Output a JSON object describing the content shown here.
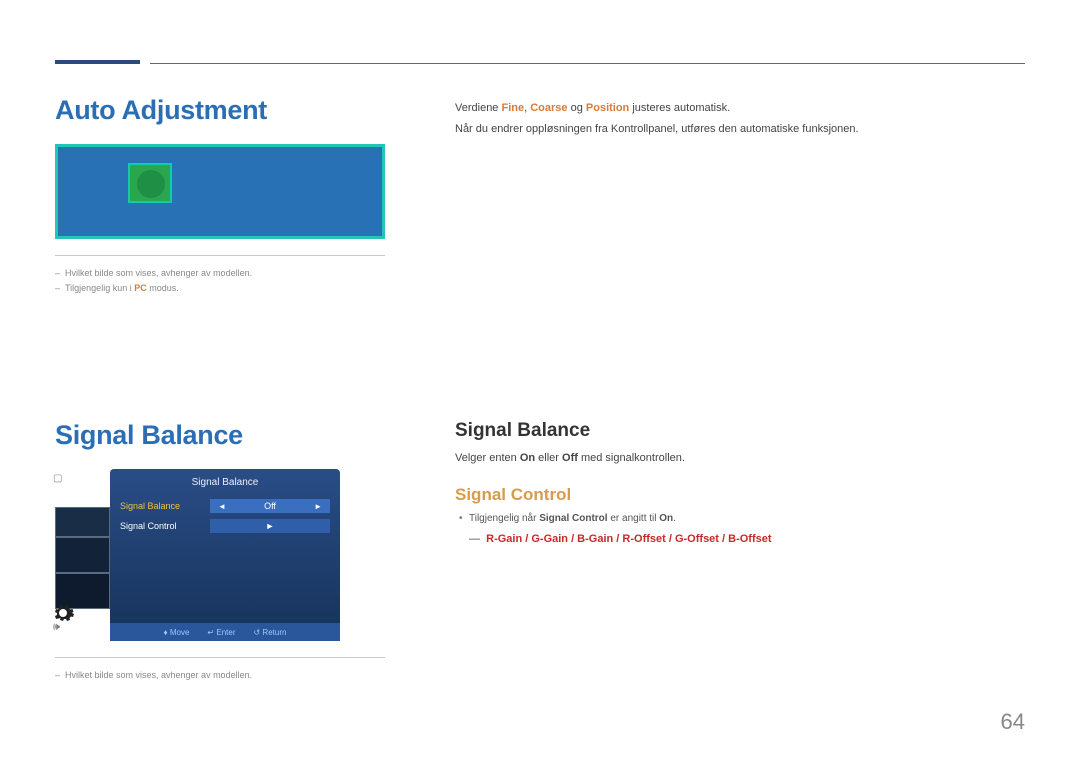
{
  "page_number": "64",
  "section1": {
    "title_left": "Auto Adjustment",
    "footnote1": "Hvilket bilde som vises, avhenger av modellen.",
    "footnote2_pre": "Tilgjengelig kun i ",
    "footnote2_accent": "PC",
    "footnote2_post": " modus.",
    "body_line1_pre": "Verdiene ",
    "body_line1_a": "Fine",
    "body_line1_sep1": ", ",
    "body_line1_b": "Coarse",
    "body_line1_sep2": " og ",
    "body_line1_c": "Position",
    "body_line1_post": " justeres automatisk.",
    "body_line2": "Når du endrer oppløsningen fra Kontrollpanel, utføres den automatiske funksjonen."
  },
  "section2": {
    "title_left": "Signal Balance",
    "osd": {
      "panel_title": "Signal Balance",
      "row1_label": "Signal Balance",
      "row1_arrow_l": "◄",
      "row1_value": "Off",
      "row1_arrow_r": "►",
      "row2_label": "Signal Control",
      "row2_arrow_r": "►",
      "footer_move": "Move",
      "footer_enter": "Enter",
      "footer_return": "Return"
    },
    "footnote1": "Hvilket bilde som vises, avhenger av modellen.",
    "right_h2": "Signal Balance",
    "right_body_pre": "Velger enten ",
    "right_body_on": "On",
    "right_body_mid": " eller ",
    "right_body_off": "Off",
    "right_body_post": " med signalkontrollen.",
    "right_h3": "Signal Control",
    "bullet1_pre": "Tilgjengelig når ",
    "bullet1_b": "Signal Control",
    "bullet1_mid": " er angitt til ",
    "bullet1_on": "On",
    "bullet1_post": ".",
    "bullet2_marker": "―",
    "bullet2_red": "R-Gain / G-Gain / B-Gain / R-Offset / G-Offset / B-Offset"
  }
}
